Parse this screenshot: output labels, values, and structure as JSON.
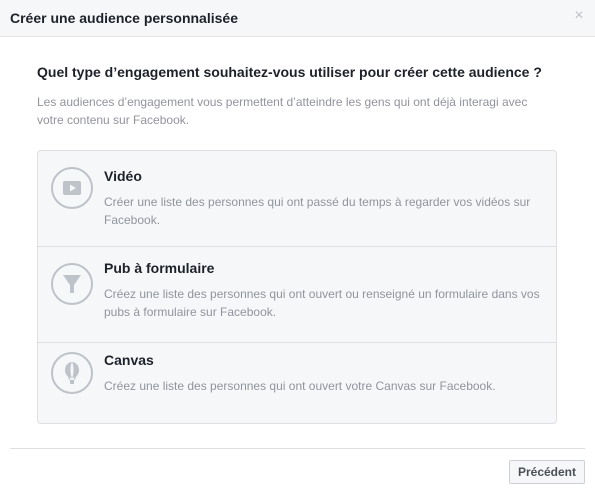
{
  "dialog": {
    "title": "Créer une audience personnalisée",
    "close_icon": "close-icon"
  },
  "content": {
    "question": "Quel type d’engagement souhaitez-vous utiliser pour créer cette audience ?",
    "description": "Les audiences d’engagement vous permettent d’atteindre les gens qui ont déjà interagi avec votre contenu sur Facebook."
  },
  "options": [
    {
      "title": "Vidéo",
      "description": "Créer une liste des personnes qui ont passé du temps à regarder vos vidéos sur Facebook.",
      "icon": "video-play-icon"
    },
    {
      "title": "Pub à formulaire",
      "description": "Créez une liste des personnes qui ont ouvert ou renseigné un formulaire dans vos pubs à formulaire sur Facebook.",
      "icon": "funnel-icon"
    },
    {
      "title": "Canvas",
      "description": "Créez une liste des personnes qui ont ouvert votre Canvas sur Facebook.",
      "icon": "balloon-icon"
    }
  ],
  "footer": {
    "previous_label": "Précédent"
  },
  "colors": {
    "header_bg": "#f6f7f9",
    "text_primary": "#1d2129",
    "text_secondary": "#90949c",
    "border": "#dddfe2",
    "icon_gray": "#bec2c9"
  }
}
